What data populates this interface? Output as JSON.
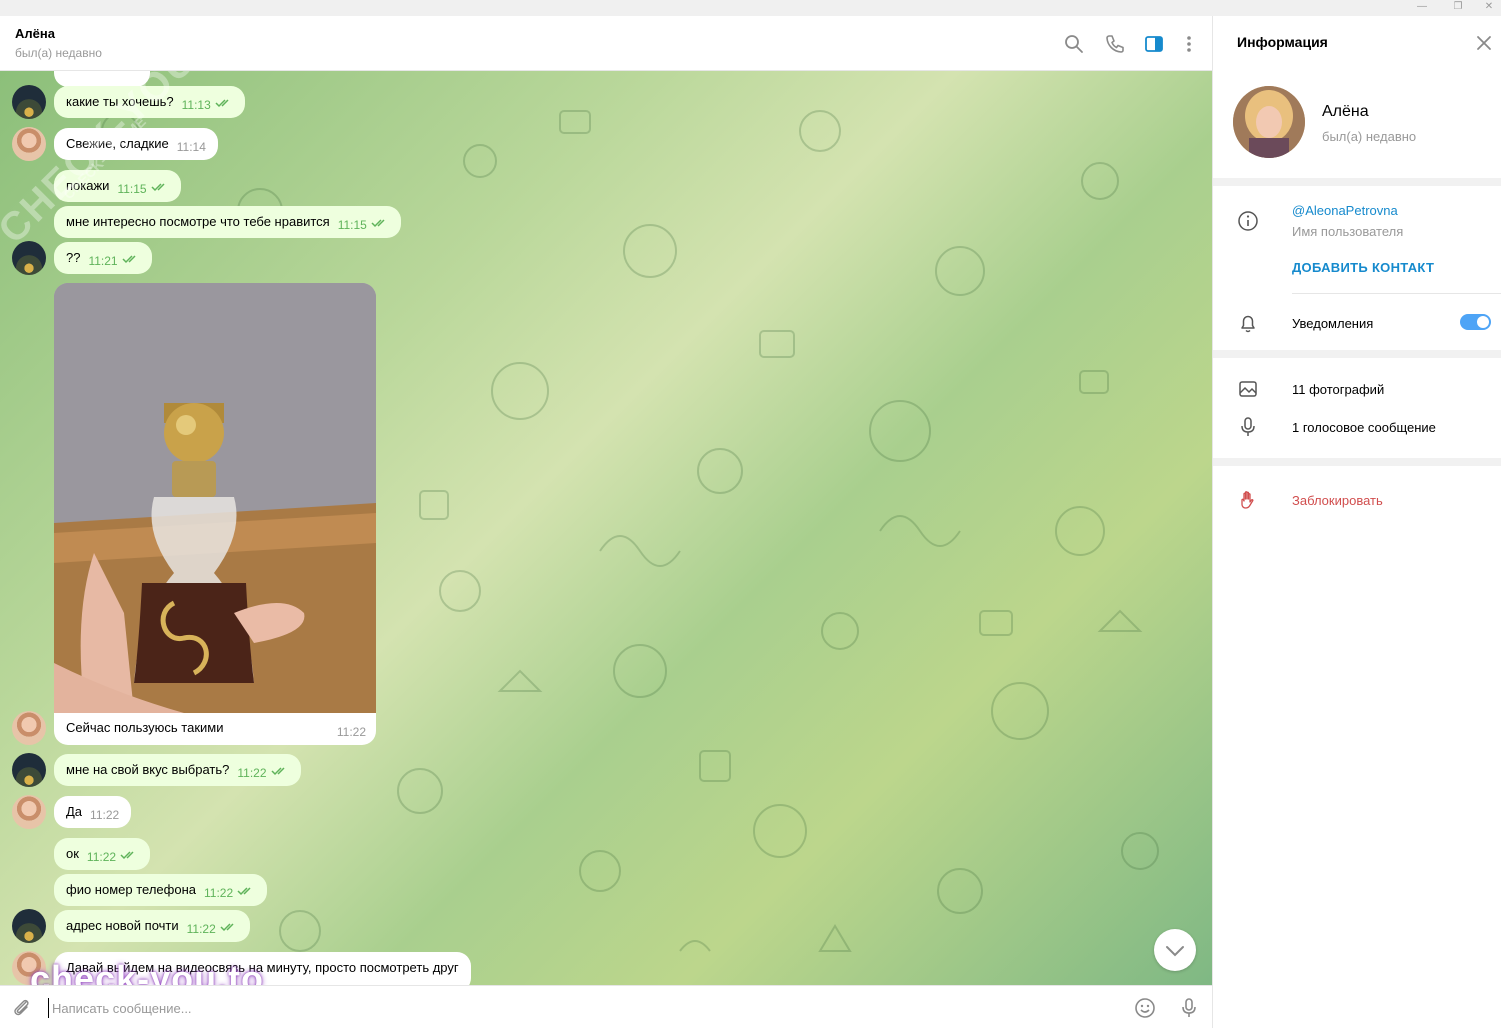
{
  "window": {
    "minimize_glyph": "—",
    "restore_glyph": "❐",
    "close_glyph": "✕"
  },
  "chat_header": {
    "name": "Алёна",
    "status": "был(а) недавно"
  },
  "messages": [
    {
      "text": "какие ты хочешь?",
      "time": "11:13",
      "outgoing": true
    },
    {
      "text": "Свежие, сладкие",
      "time": "11:14",
      "outgoing": false
    },
    {
      "text": "покажи",
      "time": "11:15",
      "outgoing": true
    },
    {
      "text": "мне интересно посмотре что тебе нравится",
      "time": "11:15",
      "outgoing": true
    },
    {
      "text": "??",
      "time": "11:21",
      "outgoing": true
    },
    {
      "text": "Сейчас пользуюсь такими",
      "time": "11:22",
      "outgoing": false
    },
    {
      "text": "мне на свой вкус выбрать?",
      "time": "11:22",
      "outgoing": true
    },
    {
      "text": "Да",
      "time": "11:22",
      "outgoing": false
    },
    {
      "text": "ок",
      "time": "11:22",
      "outgoing": true
    },
    {
      "text": "фио номер телефона",
      "time": "11:22",
      "outgoing": true
    },
    {
      "text": "адрес новой почти",
      "time": "11:22",
      "outgoing": true
    },
    {
      "text": "Давай выйдем на видеосвязь на минуту, просто посмотреть друг",
      "time": "",
      "outgoing": false
    }
  ],
  "watermarks": {
    "diagonal": "CHECK-YOU.ME",
    "diagonal_small": "CHECK-YOU.ME",
    "bottom": "check-you.to"
  },
  "composer": {
    "placeholder": "Написать сообщение..."
  },
  "info_panel": {
    "title": "Информация",
    "name": "Алёна",
    "status": "был(а) недавно",
    "username": "@AleonaPetrovna",
    "username_label": "Имя пользователя",
    "add_contact": "ДОБАВИТЬ КОНТАКТ",
    "notifications_label": "Уведомления",
    "notifications_on": true,
    "photos": "11 фотографий",
    "voice": "1 голосовое сообщение",
    "block": "Заблокировать"
  },
  "colors": {
    "accent": "#168acd",
    "outgoing_bubble": "#eeffde",
    "read_ticks": "#5fb35a",
    "danger": "#d14e4e",
    "toggle": "#4ea4f6"
  },
  "icons": [
    "search-icon",
    "phone-icon",
    "sidebar-toggle-icon",
    "more-vertical-icon",
    "close-icon",
    "info-icon",
    "bell-icon",
    "photo-icon",
    "microphone-icon",
    "hand-block-icon",
    "paperclip-icon",
    "emoji-icon",
    "chevron-down-icon",
    "double-check-icon"
  ]
}
